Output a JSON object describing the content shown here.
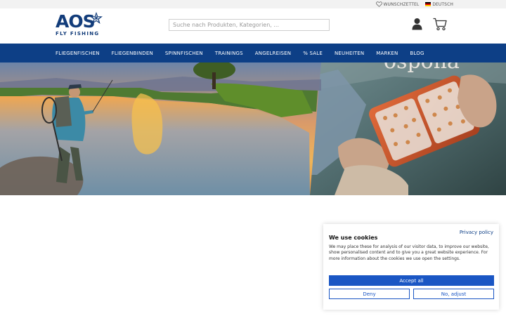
{
  "topbar": {
    "wishlist_label": "WUNSCHZETTEL",
    "language_label": "DEUTSCH"
  },
  "header": {
    "logo_main": "AOS",
    "logo_sub": "FLY FISHING",
    "search_placeholder": "Suche nach Produkten, Kategorien, ..."
  },
  "nav": {
    "items": [
      {
        "label": "FLIEGENFISCHEN"
      },
      {
        "label": "FLIEGENBINDEN"
      },
      {
        "label": "SPINNFISCHEN"
      },
      {
        "label": "TRAININGS"
      },
      {
        "label": "ANGELREISEN"
      },
      {
        "label": "% SALE"
      },
      {
        "label": "NEUHEITEN"
      },
      {
        "label": "MARKEN"
      },
      {
        "label": "BLOG"
      }
    ]
  },
  "cookie": {
    "privacy_link": "Privacy policy",
    "title": "We use cookies",
    "text": "We may place these for analysis of our visitor data, to improve our website, show personalised content and to give you a great website experience. For more information about the cookies we use open the settings.",
    "accept_label": "Accept all",
    "deny_label": "Deny",
    "adjust_label": "No, adjust"
  },
  "colors": {
    "brand": "#123c7a",
    "nav_bg": "#0d3f86",
    "accent": "#1a56c4"
  }
}
